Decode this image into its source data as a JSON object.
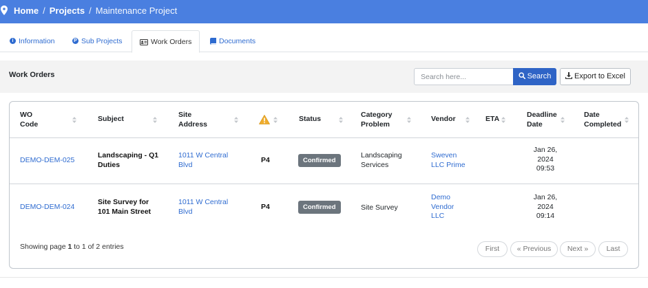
{
  "breadcrumb": {
    "home": "Home",
    "sep1": "/",
    "projects": "Projects",
    "sep2": "/",
    "current": "Maintenance Project"
  },
  "tabs": [
    {
      "label": "Information",
      "icon": "info-circle-icon"
    },
    {
      "label": "Sub Projects",
      "icon": "p-circle-icon"
    },
    {
      "label": "Work Orders",
      "icon": "id-card-icon",
      "active": true
    },
    {
      "label": "Documents",
      "icon": "book-icon"
    }
  ],
  "section": {
    "title": "Work Orders",
    "search_placeholder": "Search here...",
    "search_label": "Search",
    "export_label": "Export to Excel"
  },
  "table": {
    "columns": [
      {
        "line1": "WO",
        "line2": "Code"
      },
      {
        "line1": "Subject",
        "line2": ""
      },
      {
        "line1": "Site",
        "line2": "Address"
      },
      {
        "line1": "",
        "line2": "",
        "icon": "warning-icon"
      },
      {
        "line1": "Status",
        "line2": ""
      },
      {
        "line1": "Category",
        "line2": "Problem"
      },
      {
        "line1": "Vendor",
        "line2": ""
      },
      {
        "line1": "ETA",
        "line2": ""
      },
      {
        "line1": "Deadline",
        "line2": "Date"
      },
      {
        "line1": "Date",
        "line2": "Completed"
      }
    ],
    "rows": [
      {
        "code": "DEMO-DEM-025",
        "subject": [
          "Landscaping - Q1",
          "Duties"
        ],
        "address": [
          "1011 W Central",
          "Blvd"
        ],
        "priority": "P4",
        "status": "Confirmed",
        "category": [
          "Landscaping",
          "Services"
        ],
        "vendor": [
          "Sweven",
          "LLC Prime"
        ],
        "eta": "",
        "deadline": [
          "Jan 26,",
          "2024",
          "09:53"
        ],
        "completed": ""
      },
      {
        "code": "DEMO-DEM-024",
        "subject": [
          "Site Survey for",
          "101 Main Street"
        ],
        "address": [
          "1011 W Central",
          "Blvd"
        ],
        "priority": "P4",
        "status": "Confirmed",
        "category": [
          "Site Survey"
        ],
        "vendor": [
          "Demo",
          "Vendor",
          "LLC"
        ],
        "eta": "",
        "deadline": [
          "Jan 26,",
          "2024",
          "09:14"
        ],
        "completed": ""
      }
    ]
  },
  "pagination": {
    "info_prefix": "Showing page ",
    "page": "1",
    "info_mid": " to ",
    "total_pages": "1",
    "info_of": " of ",
    "entries": "2",
    "info_suffix": " entries",
    "first": "First",
    "previous": "« Previous",
    "next": "Next »",
    "last": "Last"
  },
  "colors": {
    "topbar": "#4a7fe0",
    "link": "#2e6bd0",
    "primary_button": "#2f64c6",
    "badge": "#6c757d",
    "warning": "#f0ad2e"
  }
}
